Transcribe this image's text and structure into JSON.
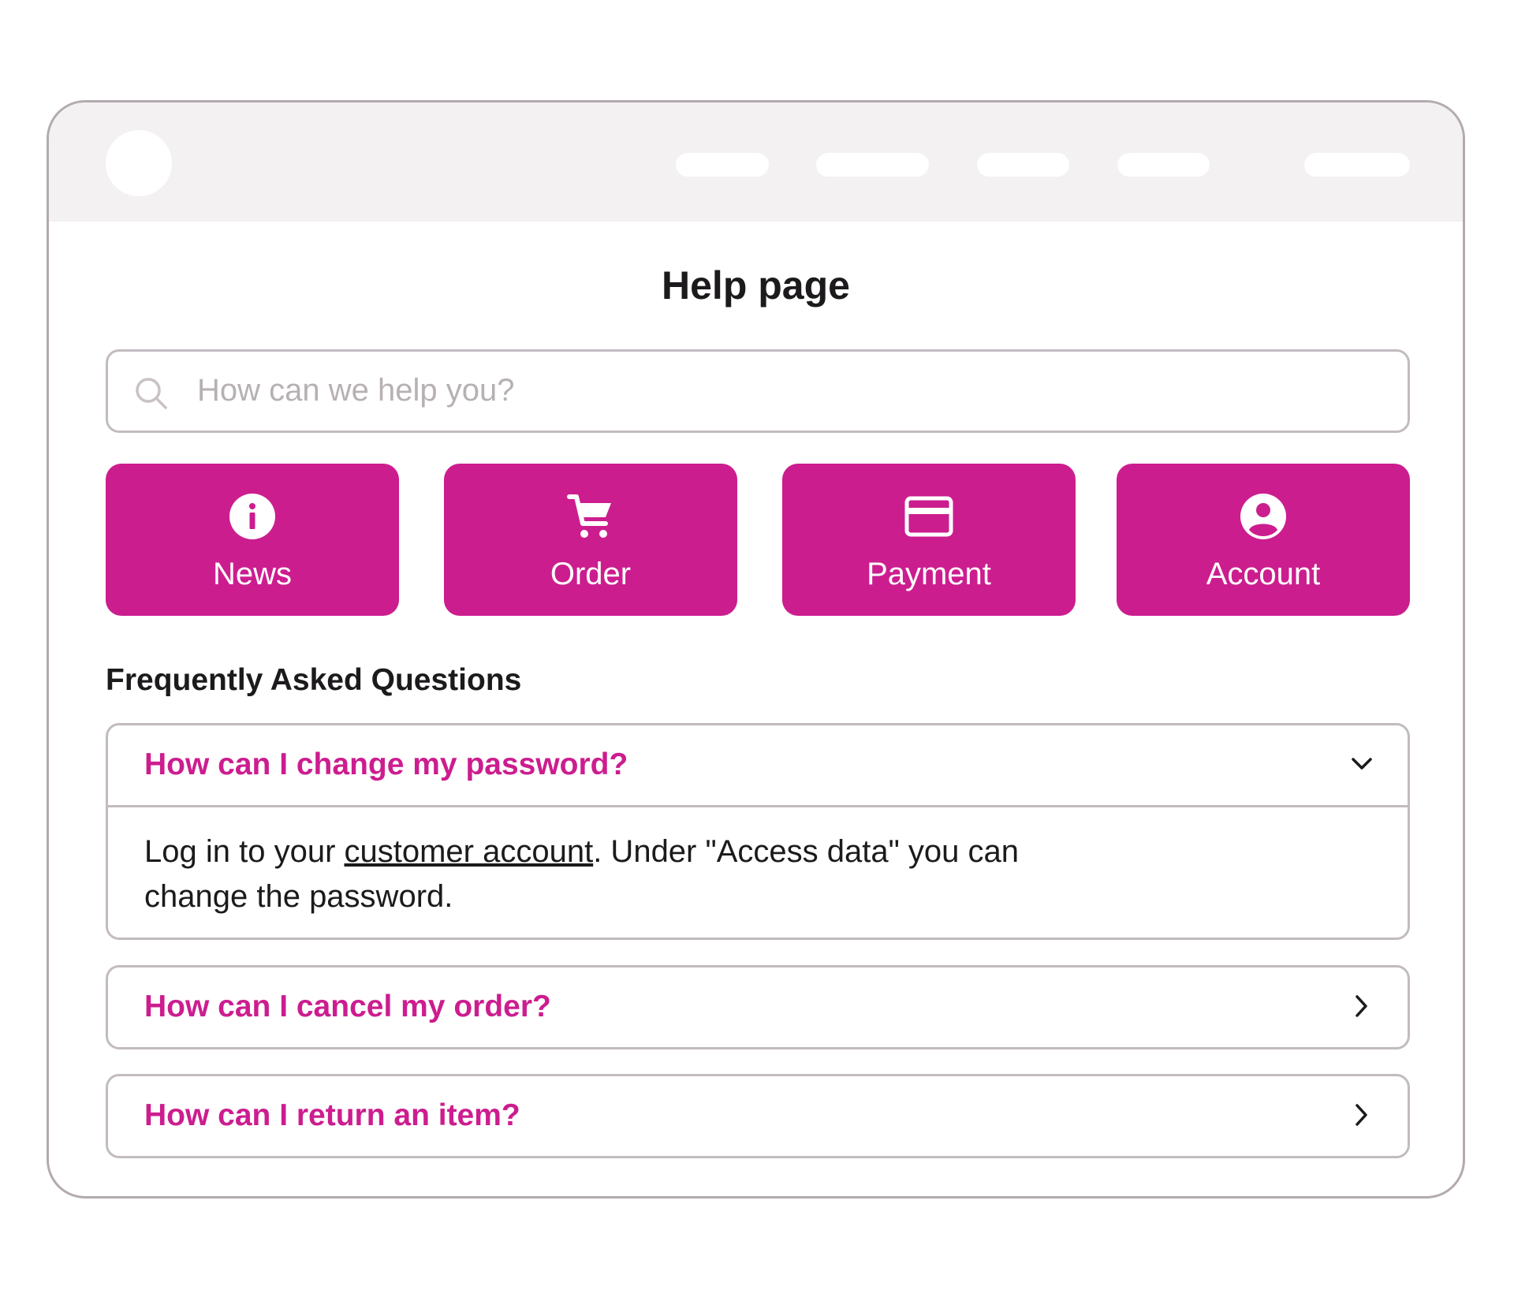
{
  "page": {
    "title": "Help page"
  },
  "search": {
    "placeholder": "How can we help you?",
    "icon": "search-icon"
  },
  "categories": [
    {
      "label": "News",
      "icon": "info-icon"
    },
    {
      "label": "Order",
      "icon": "cart-icon"
    },
    {
      "label": "Payment",
      "icon": "credit-card-icon"
    },
    {
      "label": "Account",
      "icon": "account-circle-icon"
    }
  ],
  "faq": {
    "heading": "Frequently Asked Questions",
    "items": [
      {
        "question": "How can I change my password?",
        "expanded": true,
        "answer_before": "Log in to your ",
        "answer_link": "customer account",
        "answer_after": ". Under \"Access data\" you can",
        "answer_line2": "change the password."
      },
      {
        "question": "How can I cancel my order?",
        "expanded": false
      },
      {
        "question": "How can I return an item?",
        "expanded": false
      }
    ]
  },
  "colors": {
    "accent": "#cc1d8f",
    "border": "#c2bbc0",
    "topbar": "#f3f1f2"
  }
}
